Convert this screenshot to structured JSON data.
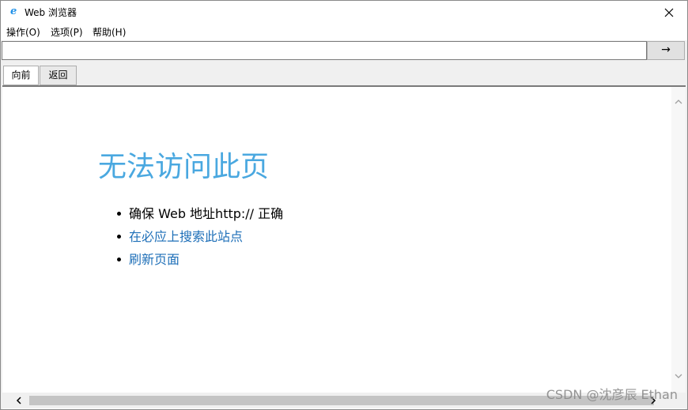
{
  "window": {
    "title": "Web 浏览器",
    "app_icon": "ie-browser-icon",
    "close_icon": "close-icon"
  },
  "menu": {
    "items": [
      {
        "label": "操作(O)"
      },
      {
        "label": "选项(P)"
      },
      {
        "label": "帮助(H)"
      }
    ]
  },
  "address": {
    "value": "",
    "go_label": "→"
  },
  "nav": {
    "forward_label": "向前",
    "back_label": "返回"
  },
  "page": {
    "heading": "无法访问此页",
    "bullets": [
      {
        "text": "确保 Web 地址http:// 正确",
        "link": false
      },
      {
        "text": "在必应上搜索此站点",
        "link": true
      },
      {
        "text": "刷新页面",
        "link": true
      }
    ]
  },
  "watermark": "CSDN @沈彦辰 Ethan",
  "colors": {
    "heading": "#4aa8e0",
    "link": "#1e6fb8",
    "icon": "#1e90e8"
  }
}
